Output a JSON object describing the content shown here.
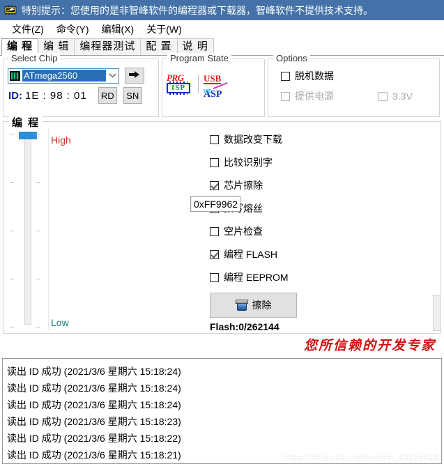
{
  "banner": {
    "icon": "chip-icon",
    "text": "特别提示：您使用的是非智峰软件的编程器或下载器，智峰软件不提供技术支持。",
    "background": "#4472a8",
    "color": "#ffffff"
  },
  "menubar": {
    "items": [
      {
        "label": "文件(Z)"
      },
      {
        "label": "命令(Y)"
      },
      {
        "label": "编辑(X)"
      },
      {
        "label": "关于(W)"
      }
    ]
  },
  "tabs": [
    {
      "label": "编 程",
      "active": true
    },
    {
      "label": "编 辑",
      "active": false
    },
    {
      "label": "编程器测试",
      "active": false
    },
    {
      "label": "配 置",
      "active": false
    },
    {
      "label": "说 明",
      "active": false
    }
  ],
  "select_chip": {
    "legend": "Select Chip",
    "combo": {
      "value": "ATmega2560",
      "icon": "chip-icon",
      "dropdown_icon": "chevron-down-icon",
      "selected_highlight": "#2a6fb8"
    },
    "go_button": {
      "icon": "right-arrow-icon"
    },
    "id": {
      "label": "ID:",
      "value": "1E : 98 : 01",
      "label_color": "#10229b"
    },
    "rd_button": "RD",
    "sn_button": "SN"
  },
  "program_state": {
    "legend": "Program State",
    "icons": [
      {
        "name": "prg-isp-icon",
        "top": "PRG",
        "bottom": "ISP"
      },
      {
        "name": "usb-asp-icon",
        "top": "USB",
        "middle": "HID",
        "bottom": "ASP"
      }
    ]
  },
  "options": {
    "legend": "Options",
    "items": [
      {
        "label": "脱机数据",
        "checked": false,
        "disabled": false
      },
      {
        "label": "提供电源",
        "checked": false,
        "disabled": true
      },
      {
        "label": "3.3V",
        "checked": false,
        "disabled": true
      }
    ]
  },
  "program_panel": {
    "legend": "编 程",
    "trackbar": {
      "high_label": "High",
      "low_label": "Low",
      "high_color": "#c0392b",
      "low_color": "#1a7a7a",
      "thumb_color": "#2a8fd6",
      "position": "high"
    },
    "checkboxes": [
      {
        "label": "数据改变下载",
        "checked": false
      },
      {
        "label": "比较识别字",
        "checked": false
      },
      {
        "label": "芯片擦除",
        "checked": true
      },
      {
        "label": "预写熔丝",
        "checked": false
      },
      {
        "label": "空片检查",
        "checked": false
      },
      {
        "label": "编程 FLASH",
        "checked": true
      },
      {
        "label": "编程 EEPROM",
        "checked": false
      }
    ],
    "fuse_value": "0xFF9962",
    "erase_button": {
      "label": "擦除",
      "icon": "trash-bin-icon"
    },
    "flash_status": "Flash:0/262144"
  },
  "slogan": {
    "text": "您所信赖的开发专家",
    "color": "#d01212"
  },
  "log": {
    "lines": [
      "读出 ID 成功 (2021/3/6 星期六 15:18:24)",
      "读出 ID 成功 (2021/3/6 星期六 15:18:24)",
      "读出 ID 成功 (2021/3/6 星期六 15:18:24)",
      "读出 ID 成功 (2021/3/6 星期六 15:18:23)",
      "读出 ID 成功 (2021/3/6 星期六 15:18:22)",
      "读出 ID 成功 (2021/3/6 星期六 15:18:21)"
    ]
  },
  "watermark": "https://blog.csdn.net/weixin_43159428"
}
